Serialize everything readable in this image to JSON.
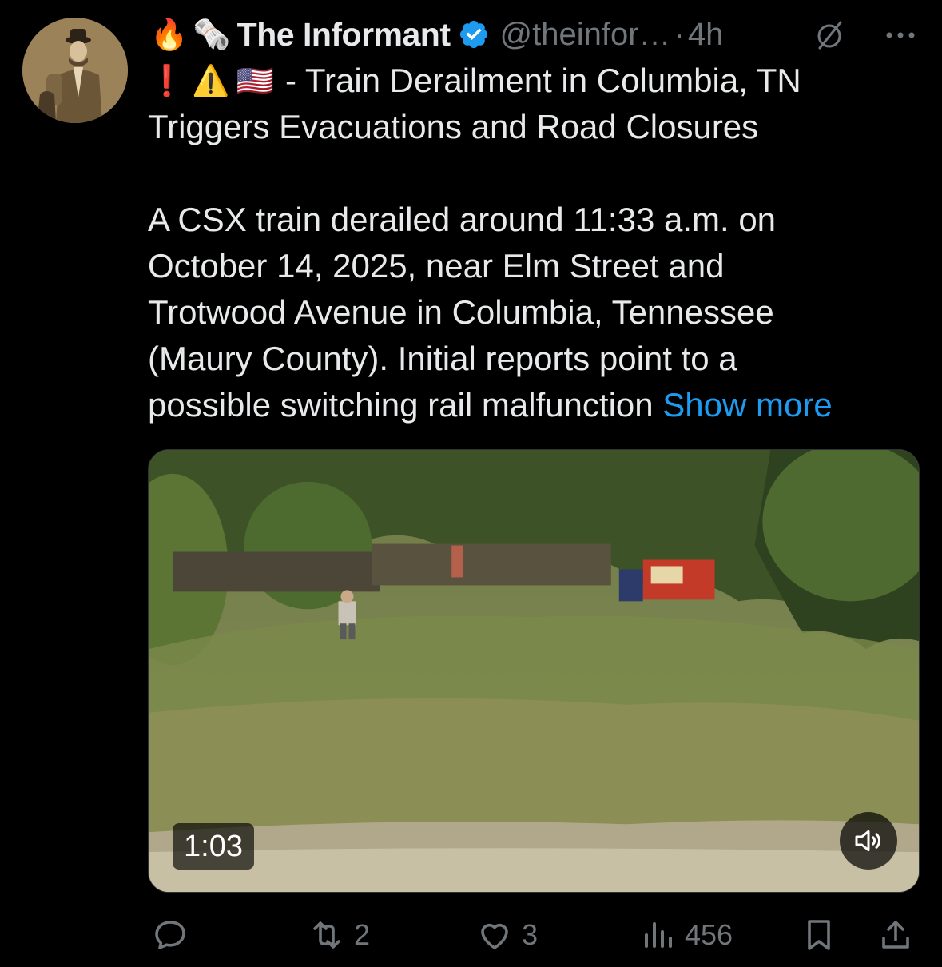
{
  "author": {
    "name": "The Informant",
    "handle": "@theinfor…",
    "separator": "·",
    "time": "4h",
    "prefix_emojis": [
      "🔥",
      "🗞️"
    ]
  },
  "tweet": {
    "headline_emojis": [
      "❗",
      "⚠️",
      "🇺🇸"
    ],
    "headline_line1": "- Train Derailment in Columbia, TN",
    "headline_line2": "Triggers Evacuations and Road Closures",
    "body_lines": [
      "A CSX train derailed around 11:33 a.m. on",
      "October 14, 2025, near Elm Street and",
      "Trotwood Avenue in Columbia, Tennessee",
      "(Maury County). Initial reports point to a",
      "possible switching rail malfunction"
    ],
    "show_more": "Show more"
  },
  "media": {
    "duration": "1:03"
  },
  "actions": {
    "replies": "",
    "reposts": "2",
    "likes": "3",
    "views": "456"
  },
  "colors": {
    "background": "#000000",
    "text": "#e7e9ea",
    "secondary": "#71767b",
    "link": "#1d9bf0"
  },
  "icons": [
    "verified-badge-icon",
    "grok-icon",
    "more-icon",
    "reply-icon",
    "repost-icon",
    "like-icon",
    "views-icon",
    "bookmark-icon",
    "share-icon",
    "volume-icon"
  ]
}
